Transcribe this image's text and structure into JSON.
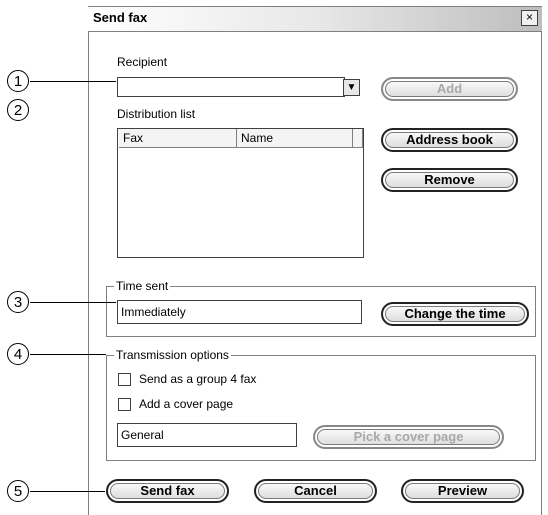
{
  "dialog": {
    "title": "Send fax",
    "close_label": "×"
  },
  "recipient": {
    "label": "Recipient",
    "value": "",
    "add_label": "Add"
  },
  "distribution": {
    "label": "Distribution list",
    "columns": [
      "Fax",
      "Name"
    ],
    "address_book_label": "Address book",
    "remove_label": "Remove"
  },
  "time": {
    "legend": "Time sent",
    "value": "Immediately",
    "change_label": "Change the time"
  },
  "options": {
    "legend": "Transmission options",
    "group4_label": "Send as a group 4 fax",
    "cover_label": "Add a cover page",
    "cover_value": "General",
    "pick_cover_label": "Pick a cover page"
  },
  "footer": {
    "send_label": "Send fax",
    "cancel_label": "Cancel",
    "preview_label": "Preview"
  },
  "callouts": [
    "1",
    "2",
    "3",
    "4",
    "5"
  ]
}
